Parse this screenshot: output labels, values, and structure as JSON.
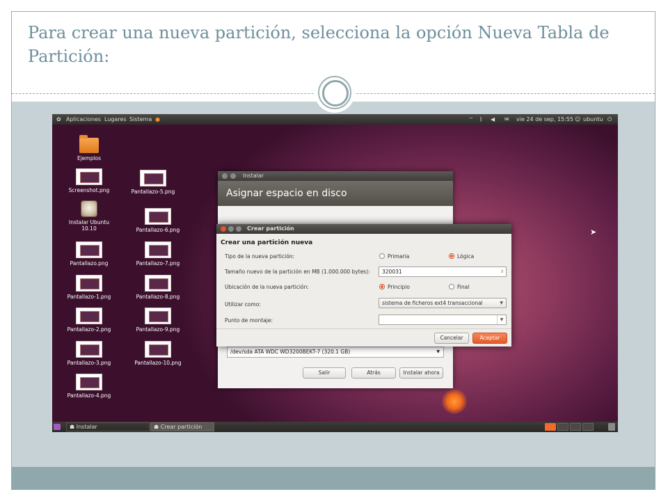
{
  "slide": {
    "title": "Para crear una nueva partición, selecciona la opción Nueva Tabla de Partición:"
  },
  "topbar": {
    "menu_apps": "Aplicaciones",
    "menu_places": "Lugares",
    "menu_system": "Sistema",
    "clock": "vie 24 de sep, 15:55",
    "user": "ubuntu"
  },
  "desktop_icons": [
    {
      "label": "Ejemplos"
    },
    {
      "label": "Screenshot.png"
    },
    {
      "label": "Pantallazo-5.png"
    },
    {
      "label": "Instalar Ubuntu 10.10"
    },
    {
      "label": "Pantallazo-6.png"
    },
    {
      "label": "Pantallazo.png"
    },
    {
      "label": "Pantallazo-7.png"
    },
    {
      "label": "Pantallazo-1.png"
    },
    {
      "label": "Pantallazo-8.png"
    },
    {
      "label": "Pantallazo-2.png"
    },
    {
      "label": "Pantallazo-9.png"
    },
    {
      "label": "Pantallazo-3.png"
    },
    {
      "label": "Pantallazo-10.png"
    },
    {
      "label": "Pantallazo-4.png"
    }
  ],
  "installer": {
    "window_title": "Instalar",
    "header": "Asignar espacio en disco",
    "device_select": "/dev/sda ATA WDC WD3200BEKT-7 (320.1 GB)",
    "buttons": {
      "quit": "Salir",
      "back": "Atrás",
      "install": "Instalar ahora"
    }
  },
  "dialog": {
    "title": "Crear partición",
    "heading": "Crear una partición nueva",
    "type_label": "Tipo de la nueva partición:",
    "type_primary": "Primaria",
    "type_logical": "Lógica",
    "size_label": "Tamaño nuevo de la partición en MB (1.000.000 bytes):",
    "size_value": "320031",
    "location_label": "Ubicación de la nueva partición:",
    "location_start": "Principio",
    "location_end": "Final",
    "use_as_label": "Utilizar como:",
    "use_as_value": "sistema de ficheros ext4 transaccional",
    "mount_label": "Punto de montaje:",
    "mount_value": "",
    "cancel": "Cancelar",
    "accept": "Aceptar"
  },
  "taskbar": {
    "task1": "Instalar",
    "task2": "Crear partición"
  },
  "colors": {
    "accent": "#ee5b2b",
    "title_text": "#6d8f9b",
    "slide_body": "#c6d2d6",
    "slide_footer": "#8fa8ab"
  }
}
